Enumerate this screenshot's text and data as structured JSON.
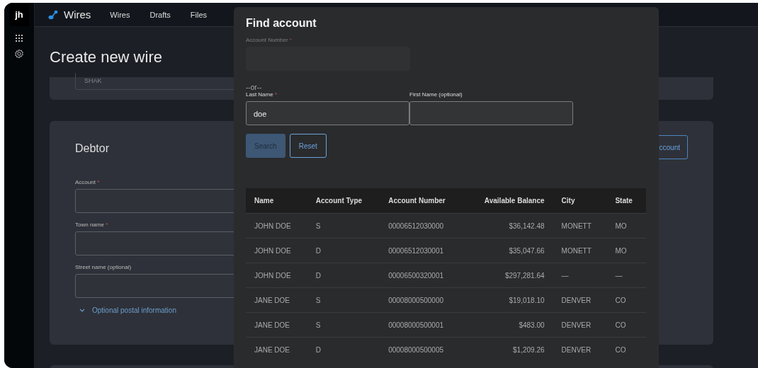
{
  "sidebar": {
    "logo": "jh"
  },
  "topbar": {
    "app_name": "Wires",
    "nav": [
      {
        "label": "Wires"
      },
      {
        "label": "Drafts"
      },
      {
        "label": "Files"
      }
    ]
  },
  "page": {
    "title": "Create new wire",
    "top_card": {
      "select_value": "SHAK"
    },
    "debtor": {
      "heading": "Debtor",
      "lookup_button": "ccount",
      "fields": [
        {
          "label": "Account",
          "required_mark": "*"
        },
        {
          "label": "Town name",
          "required_mark": "*"
        },
        {
          "label": "Street name (optional)"
        }
      ],
      "expander": {
        "label": "Optional postal information",
        "expanded": false
      }
    }
  },
  "dialog": {
    "title": "Find account",
    "account_number": {
      "label": "Account Number",
      "required_mark": "*",
      "disabled": true
    },
    "separator": "--or--",
    "last_name": {
      "label": "Last Name",
      "required_mark": "*",
      "value": "doe"
    },
    "first_name": {
      "label": "First Name (optional)"
    },
    "buttons": [
      {
        "label": "Search",
        "kind": "primary",
        "disabled": true
      },
      {
        "label": "Reset",
        "kind": "outline",
        "disabled": false
      }
    ],
    "table": {
      "columns": [
        {
          "label": "Name",
          "kind": "text"
        },
        {
          "label": "Account Type",
          "kind": "text"
        },
        {
          "label": "Account Number",
          "kind": "text"
        },
        {
          "label": "Available Balance",
          "kind": "money"
        },
        {
          "label": "City",
          "kind": "text"
        },
        {
          "label": "State",
          "kind": "text"
        }
      ],
      "rows": [
        [
          "JOHN DOE",
          "S",
          "00006512030000",
          "$36,142.48",
          "MONETT",
          "MO"
        ],
        [
          "JOHN DOE",
          "D",
          "00006512030001",
          "$35,047.66",
          "MONETT",
          "MO"
        ],
        [
          "JOHN DOE",
          "D",
          "00006500320001",
          "$297,281.64",
          "—",
          "—"
        ],
        [
          "JANE DOE",
          "S",
          "00008000500000",
          "$19,018.10",
          "DENVER",
          "CO"
        ],
        [
          "JANE DOE",
          "S",
          "00008000500001",
          "$483.00",
          "DENVER",
          "CO"
        ],
        [
          "JANE DOE",
          "D",
          "00008000500005",
          "$1,209.26",
          "DENVER",
          "CO"
        ]
      ]
    }
  }
}
